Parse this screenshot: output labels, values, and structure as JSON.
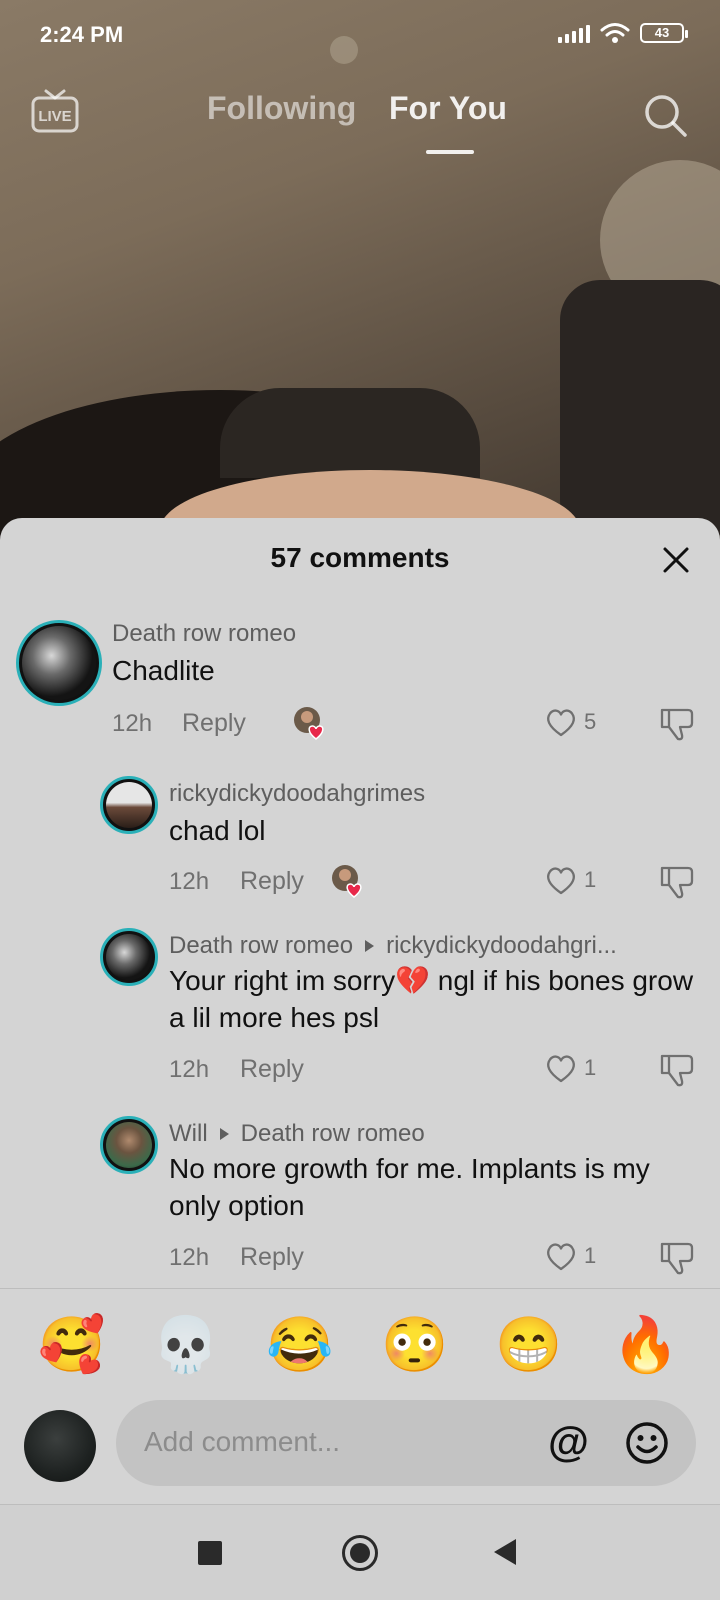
{
  "status_bar": {
    "time": "2:24 PM",
    "battery": "43"
  },
  "top_nav": {
    "live_label": "LIVE",
    "tabs": [
      {
        "label": "Following",
        "active": false
      },
      {
        "label": "For You",
        "active": true
      }
    ]
  },
  "comments_sheet": {
    "title": "57 comments",
    "comments": [
      {
        "user": "Death row romeo",
        "reply_to": "",
        "text": "Chadlite",
        "time": "12h",
        "reply_label": "Reply",
        "likes": "5",
        "liked_by_creator": true
      },
      {
        "user": "rickydickydoodahgrimes",
        "reply_to": "",
        "text": "chad lol",
        "time": "12h",
        "reply_label": "Reply",
        "likes": "1",
        "liked_by_creator": true
      },
      {
        "user": "Death row romeo",
        "reply_to": "rickydickydoodahgri...",
        "text": "Your right im sorry💔 ngl if his bones grow a lil more hes psl",
        "time": "12h",
        "reply_label": "Reply",
        "likes": "1",
        "liked_by_creator": false
      },
      {
        "user": "Will",
        "reply_to": "Death row romeo",
        "text": "No more growth for me. Implants is my only option",
        "time": "12h",
        "reply_label": "Reply",
        "likes": "1",
        "liked_by_creator": false
      }
    ]
  },
  "emoji_bar": [
    "🥰",
    "💀",
    "😂",
    "😳",
    "😁",
    "🔥"
  ],
  "composer": {
    "placeholder": "Add comment...",
    "mention_symbol": "@"
  },
  "colors": {
    "sheet_bg": "#d4d4d4",
    "avatar_ring": "#2ab0b8",
    "heart_red": "#e8284a"
  }
}
